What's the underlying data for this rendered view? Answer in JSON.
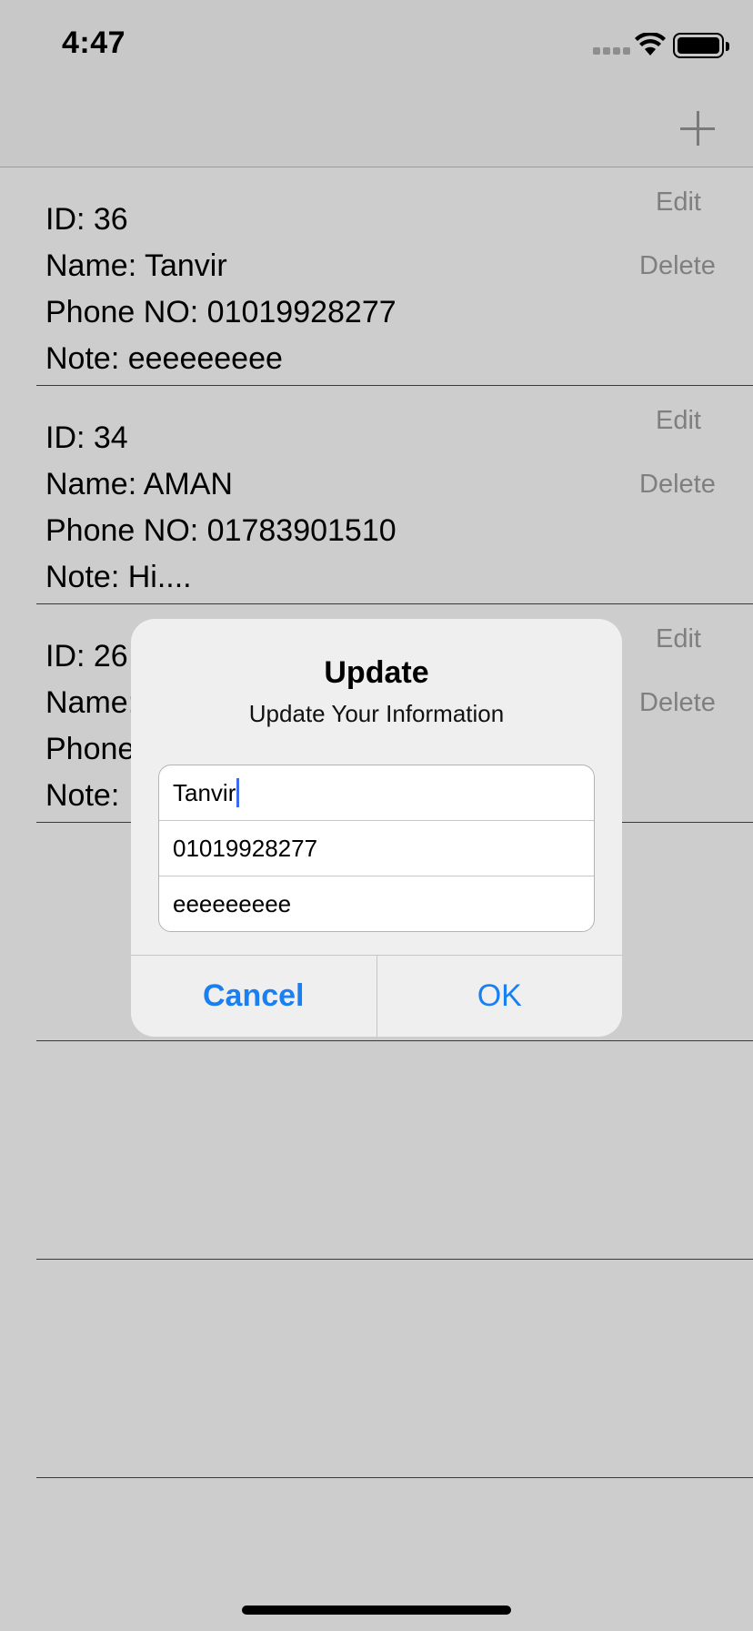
{
  "status_bar": {
    "time": "4:47"
  },
  "nav": {
    "add_icon": "plus-icon"
  },
  "rows": [
    {
      "id": "ID: 36",
      "name": "Name: Tanvir",
      "phone": "Phone NO: 01019928277",
      "note": "Note: eeeeeeeee",
      "edit": "Edit",
      "delete": "Delete"
    },
    {
      "id": "ID: 34",
      "name": "Name: AMAN",
      "phone": "Phone NO: 01783901510",
      "note": "Note: Hi....",
      "edit": "Edit",
      "delete": "Delete"
    },
    {
      "id": "ID: 26",
      "name": "Name:",
      "phone": "Phone",
      "note": "Note:",
      "edit": "Edit",
      "delete": "Delete"
    }
  ],
  "alert": {
    "title": "Update",
    "message": "Update Your Information",
    "fields": [
      "Tanvir",
      "01019928277",
      "eeeeeeeee"
    ],
    "cancel_label": "Cancel",
    "ok_label": "OK"
  },
  "colors": {
    "accent": "#1a7ff0",
    "separator": "#2a2aa8",
    "background": "#cdcdcd"
  }
}
